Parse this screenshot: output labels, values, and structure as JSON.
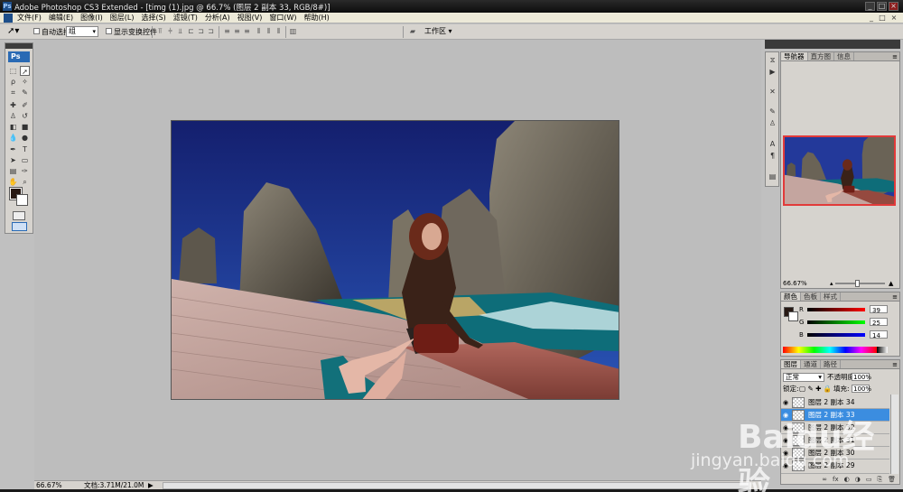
{
  "window": {
    "title": "Adobe Photoshop CS3 Extended - [timg (1).jpg @ 66.7% (图层 2 副本 33, RGB/8#)]",
    "controls": [
      "_",
      "□",
      "×"
    ]
  },
  "menubar": {
    "items": [
      "文件(F)",
      "编辑(E)",
      "图像(I)",
      "图层(L)",
      "选择(S)",
      "滤镜(T)",
      "分析(A)",
      "视图(V)",
      "窗口(W)",
      "帮助(H)"
    ],
    "doc_controls": [
      "_",
      "□",
      "×"
    ]
  },
  "options": {
    "auto_select_label": "自动选择:",
    "auto_select_value": "组",
    "show_transform_label": "显示变换控件",
    "workspace_label": "工作区 ▾"
  },
  "tools": {
    "logo": "Ps",
    "foreground_color": "#271914",
    "background_color": "#ffffff"
  },
  "canvas": {
    "image": "photo-composite-woman-on-steps-with-rocks-and-sea"
  },
  "status": {
    "zoom": "66.67%",
    "doc_size": "文档:3.71M/21.0M",
    "arrow": "▶"
  },
  "navigator": {
    "tabs": [
      "导航器",
      "直方图",
      "信息"
    ],
    "zoom": "66.67%"
  },
  "color_panel": {
    "tabs": [
      "颜色",
      "色板",
      "样式"
    ],
    "channels": [
      {
        "label": "R",
        "value": "39",
        "color": "#c02020"
      },
      {
        "label": "G",
        "value": "25",
        "color": "#20a020"
      },
      {
        "label": "B",
        "value": "14",
        "color": "#2030c0"
      }
    ]
  },
  "layers_panel": {
    "tabs": [
      "图层",
      "通道",
      "路径"
    ],
    "blend_mode": "正常",
    "opacity_label": "不透明度:",
    "opacity_value": "100%",
    "lock_label": "锁定:",
    "fill_label": "填充:",
    "fill_value": "100%",
    "layers": [
      {
        "name": "图层 2 副本 34",
        "selected": false
      },
      {
        "name": "图层 2 副本 33",
        "selected": true
      },
      {
        "name": "图层 2 副本 32",
        "selected": false
      },
      {
        "name": "图层 2 副本 31",
        "selected": false
      },
      {
        "name": "图层 2 副本 30",
        "selected": false
      },
      {
        "name": "图层 2 副本 29",
        "selected": false
      }
    ],
    "footer_icons": [
      "∞",
      "fx",
      "◐",
      "◑",
      "▭",
      "⎘",
      "🗑"
    ]
  },
  "watermark": {
    "brand": "Baidu经验",
    "url": "jingyan.baidu.com"
  }
}
